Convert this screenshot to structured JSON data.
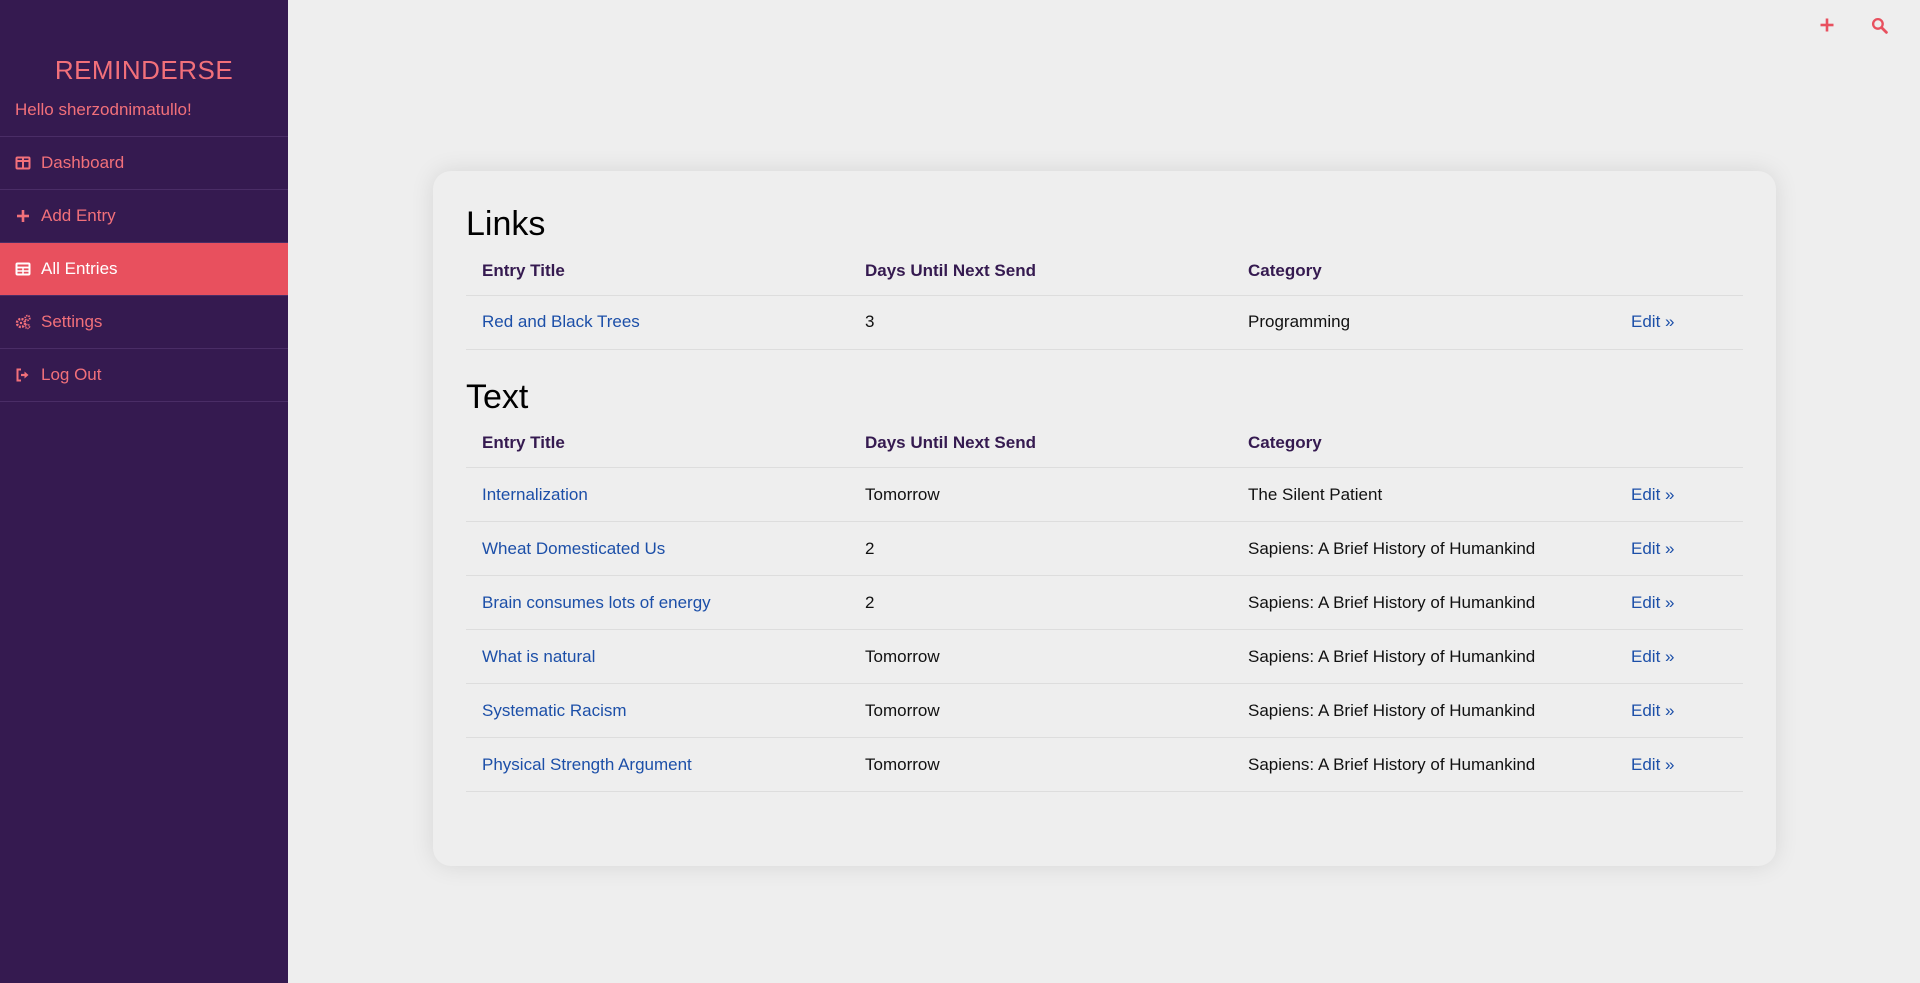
{
  "app": {
    "brand": "REMINDERSE",
    "greeting": "Hello sherzodnimatullo!"
  },
  "sidebar": {
    "items": [
      {
        "label": "Dashboard",
        "icon": "columns-icon",
        "active": false
      },
      {
        "label": "Add Entry",
        "icon": "plus-icon",
        "active": false
      },
      {
        "label": "All Entries",
        "icon": "table-icon",
        "active": true
      },
      {
        "label": "Settings",
        "icon": "cogs-icon",
        "active": false
      },
      {
        "label": "Log Out",
        "icon": "sign-out-icon",
        "active": false
      }
    ]
  },
  "top_actions": {
    "add_icon": "plus-icon",
    "search_icon": "search-icon"
  },
  "colors": {
    "sidebar_bg": "#351a50",
    "accent": "#f2707a",
    "active_bg": "#e8505e",
    "link": "#1c4fa8"
  },
  "columns": [
    "Entry Title",
    "Days Until Next Send",
    "Category"
  ],
  "links": {
    "title": "Links",
    "rows": [
      {
        "title": "Red and Black Trees",
        "days": "3",
        "category": "Programming",
        "edit": "Edit »"
      }
    ]
  },
  "text": {
    "title": "Text",
    "rows": [
      {
        "title": "Internalization",
        "days": "Tomorrow",
        "category": "The Silent Patient",
        "edit": "Edit »"
      },
      {
        "title": "Wheat Domesticated Us",
        "days": "2",
        "category": "Sapiens: A Brief History of Humankind",
        "edit": "Edit »"
      },
      {
        "title": "Brain consumes lots of energy",
        "days": "2",
        "category": "Sapiens: A Brief History of Humankind",
        "edit": "Edit »"
      },
      {
        "title": "What is natural",
        "days": "Tomorrow",
        "category": "Sapiens: A Brief History of Humankind",
        "edit": "Edit »"
      },
      {
        "title": "Systematic Racism",
        "days": "Tomorrow",
        "category": "Sapiens: A Brief History of Humankind",
        "edit": "Edit »"
      },
      {
        "title": "Physical Strength Argument",
        "days": "Tomorrow",
        "category": "Sapiens: A Brief History of Humankind",
        "edit": "Edit »"
      }
    ]
  }
}
